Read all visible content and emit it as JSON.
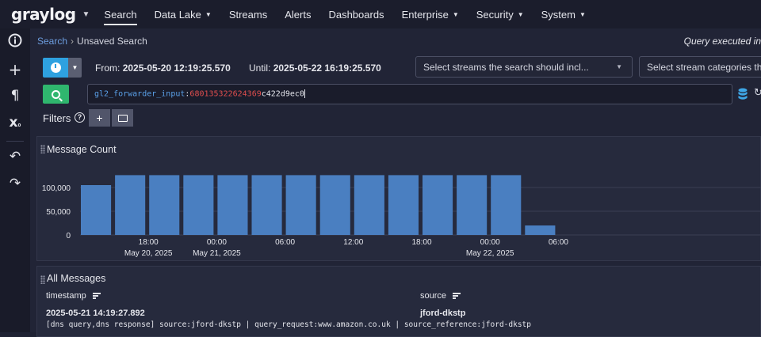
{
  "topnav": {
    "logo": "graylog",
    "items": [
      {
        "label": "Search",
        "dropdown": false,
        "active": true
      },
      {
        "label": "Data Lake",
        "dropdown": true
      },
      {
        "label": "Streams",
        "dropdown": false
      },
      {
        "label": "Alerts",
        "dropdown": false
      },
      {
        "label": "Dashboards",
        "dropdown": false
      },
      {
        "label": "Enterprise",
        "dropdown": true
      },
      {
        "label": "Security",
        "dropdown": true
      },
      {
        "label": "System",
        "dropdown": true
      }
    ]
  },
  "sidebar": {
    "icons": [
      "info-icon",
      "plus-icon",
      "paragraph-icon",
      "variable-icon",
      "undo-icon",
      "redo-icon"
    ]
  },
  "breadcrumb": {
    "root": "Search",
    "current": "Unsaved Search"
  },
  "query_info": "Query executed in",
  "time": {
    "from_label": "From:",
    "from": "2025-05-20 12:19:25.570",
    "until_label": "Until:",
    "until": "2025-05-22 16:19:25.570"
  },
  "streams_select": {
    "placeholder": "Select streams the search should incl..."
  },
  "categories_select": {
    "placeholder": "Select stream categories the"
  },
  "query": {
    "field": "gl2_forwarder_input",
    "colon": ":",
    "value_red": "680135322624369",
    "value_rest": "c422d9ec0"
  },
  "filters": {
    "label": "Filters",
    "help": "?"
  },
  "message_count": {
    "title": "Message Count",
    "chart_data": {
      "type": "bar",
      "title": "Message Count",
      "yticks": [
        "100,000",
        "50,000",
        "0"
      ],
      "ytick_values": [
        100000,
        50000,
        0
      ],
      "ylim": [
        0,
        140000
      ],
      "xticks": [
        {
          "time": "18:00",
          "date": "May 20, 2025"
        },
        {
          "time": "00:00",
          "date": "May 21, 2025"
        },
        {
          "time": "06:00",
          "date": ""
        },
        {
          "time": "12:00",
          "date": ""
        },
        {
          "time": "18:00",
          "date": ""
        },
        {
          "time": "00:00",
          "date": "May 22, 2025"
        },
        {
          "time": "06:00",
          "date": ""
        }
      ],
      "bar_interval_hours": 3,
      "bars": [
        {
          "start": "2025-05-20 12:00",
          "value": 105000
        },
        {
          "start": "2025-05-20 15:00",
          "value": 126000
        },
        {
          "start": "2025-05-20 18:00",
          "value": 126000
        },
        {
          "start": "2025-05-20 21:00",
          "value": 126000
        },
        {
          "start": "2025-05-21 00:00",
          "value": 126000
        },
        {
          "start": "2025-05-21 03:00",
          "value": 126000
        },
        {
          "start": "2025-05-21 06:00",
          "value": 126000
        },
        {
          "start": "2025-05-21 09:00",
          "value": 126000
        },
        {
          "start": "2025-05-21 12:00",
          "value": 126000
        },
        {
          "start": "2025-05-21 15:00",
          "value": 126000
        },
        {
          "start": "2025-05-21 18:00",
          "value": 126000
        },
        {
          "start": "2025-05-21 21:00",
          "value": 126000
        },
        {
          "start": "2025-05-22 00:00",
          "value": 126000
        },
        {
          "start": "2025-05-22 03:00",
          "value": 20000
        }
      ],
      "color": "#4a7fc1",
      "grid": true
    }
  },
  "all_messages": {
    "title": "All Messages",
    "columns": [
      "timestamp",
      "source"
    ],
    "rows": [
      {
        "timestamp": "2025-05-21 14:19:27.892",
        "source": "jford-dkstp",
        "message": "[dns query,dns response] source:jford-dkstp | query_request:www.amazon.co.uk | source_reference:jford-dkstp"
      }
    ]
  }
}
